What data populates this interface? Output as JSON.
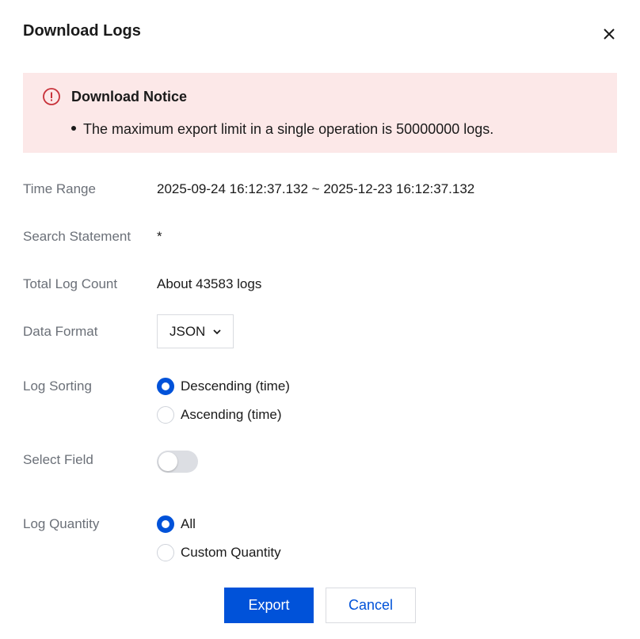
{
  "dialog": {
    "title": "Download Logs",
    "close_icon": "close-icon"
  },
  "notice": {
    "icon": "error-circle-icon",
    "title": "Download Notice",
    "items": [
      "The maximum export limit in a single operation is 50000000 logs."
    ]
  },
  "form": {
    "time_range": {
      "label": "Time Range",
      "value": "2025-09-24 16:12:37.132 ~ 2025-12-23 16:12:37.132"
    },
    "search_statement": {
      "label": "Search Statement",
      "value": "*"
    },
    "total_log_count": {
      "label": "Total Log Count",
      "value": "About 43583 logs"
    },
    "data_format": {
      "label": "Data Format",
      "selected": "JSON"
    },
    "log_sorting": {
      "label": "Log Sorting",
      "options": [
        {
          "label": "Descending (time)",
          "checked": true
        },
        {
          "label": "Ascending (time)",
          "checked": false
        }
      ]
    },
    "select_field": {
      "label": "Select Field",
      "enabled": false
    },
    "log_quantity": {
      "label": "Log Quantity",
      "options": [
        {
          "label": "All",
          "checked": true
        },
        {
          "label": "Custom Quantity",
          "checked": false
        }
      ]
    }
  },
  "buttons": {
    "export_label": "Export",
    "cancel_label": "Cancel"
  },
  "colors": {
    "primary": "#0052d9",
    "notice_bg": "#fce8e8",
    "error": "#c8323a"
  }
}
